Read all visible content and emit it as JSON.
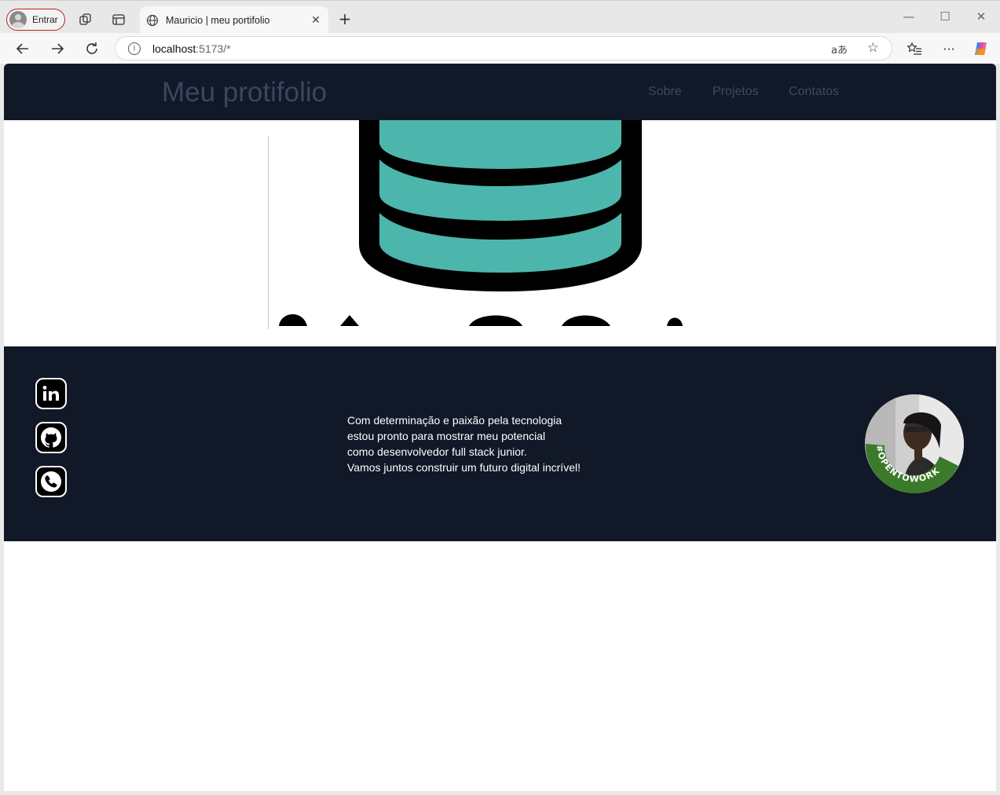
{
  "browser": {
    "profile_label": "Entrar",
    "tab_title": "Mauricio | meu portifolio",
    "url_host": "localhost",
    "url_path": ":5173/*"
  },
  "site": {
    "logo": "Meu protifolio",
    "nav": [
      "Sobre",
      "Projetos",
      "Contatos"
    ]
  },
  "footer": {
    "text_lines": [
      "Com determinação e paixão pela tecnologia",
      "estou pronto para mostrar meu potencial",
      "como desenvolvedor full stack junior.",
      "Vamos juntos construir um futuro digital incrível!"
    ],
    "badge_text": "#OPENTOWORK",
    "social_icons": [
      "linkedin-icon",
      "github-icon",
      "phone-icon"
    ]
  },
  "colors": {
    "header_bg": "#111827",
    "nav_text": "#3e4a63",
    "database_teal": "#4db6ac",
    "opentowork_green": "#3b7a2a"
  }
}
